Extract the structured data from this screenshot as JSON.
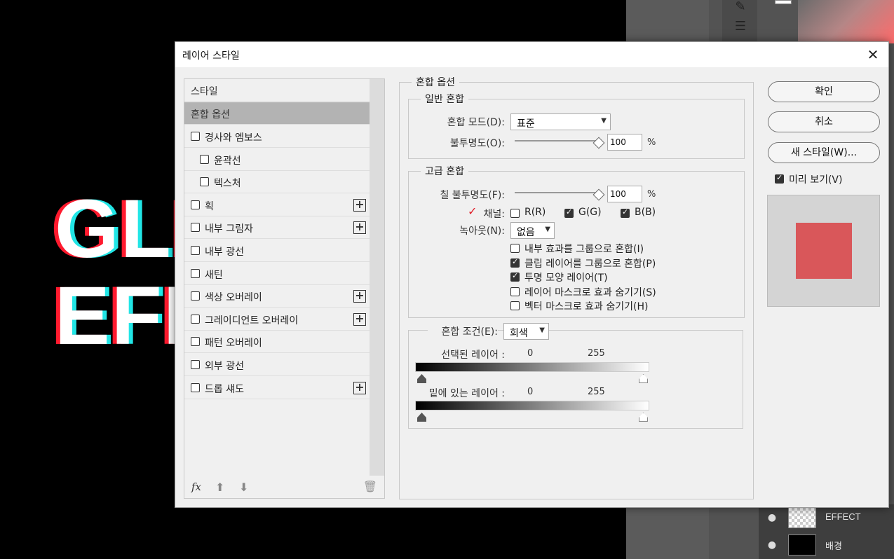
{
  "canvas": {
    "line1": "GLI",
    "line2": "EFF"
  },
  "layers": {
    "items": [
      {
        "name": "EFFECT",
        "thumb": "checker"
      },
      {
        "name": "배경",
        "thumb": "black"
      }
    ]
  },
  "dialog": {
    "title": "레이어 스타일",
    "close_label": "✕"
  },
  "styles": {
    "header": "스타일",
    "selected": "혼합 옵션",
    "items": [
      {
        "label": "경사와 엠보스",
        "indent": false,
        "plus": false,
        "checked": false
      },
      {
        "label": "윤곽선",
        "indent": true,
        "plus": false,
        "checked": false
      },
      {
        "label": "텍스처",
        "indent": true,
        "plus": false,
        "checked": false
      },
      {
        "label": "획",
        "indent": false,
        "plus": true,
        "checked": false
      },
      {
        "label": "내부 그림자",
        "indent": false,
        "plus": true,
        "checked": false
      },
      {
        "label": "내부 광선",
        "indent": false,
        "plus": false,
        "checked": false
      },
      {
        "label": "새틴",
        "indent": false,
        "plus": false,
        "checked": false
      },
      {
        "label": "색상 오버레이",
        "indent": false,
        "plus": true,
        "checked": false
      },
      {
        "label": "그레이디언트 오버레이",
        "indent": false,
        "plus": true,
        "checked": false
      },
      {
        "label": "패턴 오버레이",
        "indent": false,
        "plus": false,
        "checked": false
      },
      {
        "label": "외부 광선",
        "indent": false,
        "plus": false,
        "checked": false
      },
      {
        "label": "드롭 섀도",
        "indent": false,
        "plus": true,
        "checked": false
      }
    ],
    "fx_label": "fx"
  },
  "blending": {
    "section_title": "혼합 옵션",
    "general": {
      "title": "일반 혼합",
      "mode_label": "혼합 모드(D):",
      "mode_value": "표준",
      "opacity_label": "불투명도(O):",
      "opacity_value": "100",
      "opacity_fraction": 1.0,
      "pct": "%"
    },
    "advanced": {
      "title": "고급 혼합",
      "fill_label": "칠 불투명도(F):",
      "fill_value": "100",
      "fill_fraction": 1.0,
      "pct": "%",
      "channel_label": "채널:",
      "channels": [
        {
          "label": "R(R)",
          "checked": false
        },
        {
          "label": "G(G)",
          "checked": true
        },
        {
          "label": "B(B)",
          "checked": true
        }
      ],
      "knockout_label": "녹아웃(N):",
      "knockout_value": "없음",
      "options": [
        {
          "label": "내부 효과를 그룹으로 혼합(I)",
          "checked": false
        },
        {
          "label": "클립 레이어를 그룹으로 혼합(P)",
          "checked": true
        },
        {
          "label": "투명 모양 레이어(T)",
          "checked": true
        },
        {
          "label": "레이어 마스크로 효과 숨기기(S)",
          "checked": false
        },
        {
          "label": "벡터 마스크로 효과 숨기기(H)",
          "checked": false
        }
      ]
    },
    "blend_if": {
      "label": "혼합 조건(E):",
      "value": "회색",
      "this_layer_label": "선택된 레이어 :",
      "underlying_label": "밑에 있는 레이어 :",
      "min": "0",
      "max": "255"
    }
  },
  "buttons": {
    "ok": "확인",
    "cancel": "취소",
    "new_style": "새 스타일(W)...",
    "preview_label": "미리 보기(V)",
    "preview_checked": true,
    "preview_color": "#d9575a"
  }
}
